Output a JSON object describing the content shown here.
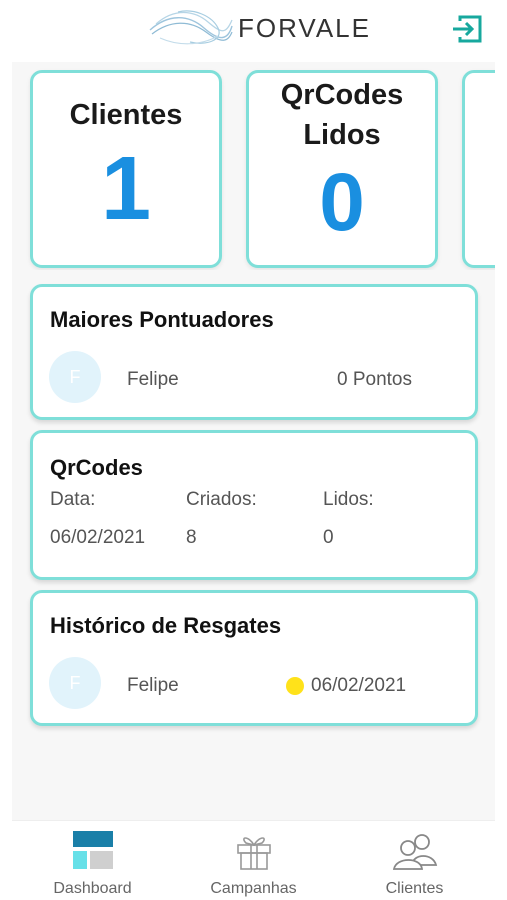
{
  "header": {
    "brand": "FORVALE",
    "logout_icon": "logout-icon"
  },
  "stats": [
    {
      "label": "Clientes",
      "value": "1"
    },
    {
      "label_line1": "QrCodes",
      "label_line2": "Lidos",
      "value": "0"
    }
  ],
  "top_scorers": {
    "title": "Maiores Pontuadores",
    "items": [
      {
        "avatar_letter": "F",
        "name": "Felipe",
        "points": "0 Pontos"
      }
    ]
  },
  "qrcodes": {
    "title": "QrCodes",
    "headers": [
      "Data:",
      "Criados:",
      "Lidos:"
    ],
    "row": [
      "06/02/2021",
      "8",
      "0"
    ]
  },
  "history": {
    "title": "Histórico de Resgates",
    "items": [
      {
        "avatar_letter": "F",
        "name": "Felipe",
        "date": "06/02/2021",
        "status_color": "#ffe21a"
      }
    ]
  },
  "nav": [
    {
      "label": "Dashboard",
      "icon": "dashboard-icon",
      "active": true
    },
    {
      "label": "Campanhas",
      "icon": "gift-icon",
      "active": false
    },
    {
      "label": "Clientes",
      "icon": "users-icon",
      "active": false
    }
  ],
  "colors": {
    "accent": "#7fdfd9",
    "value_blue": "#1a8fe0",
    "nav_active": "#1a7fa8"
  }
}
